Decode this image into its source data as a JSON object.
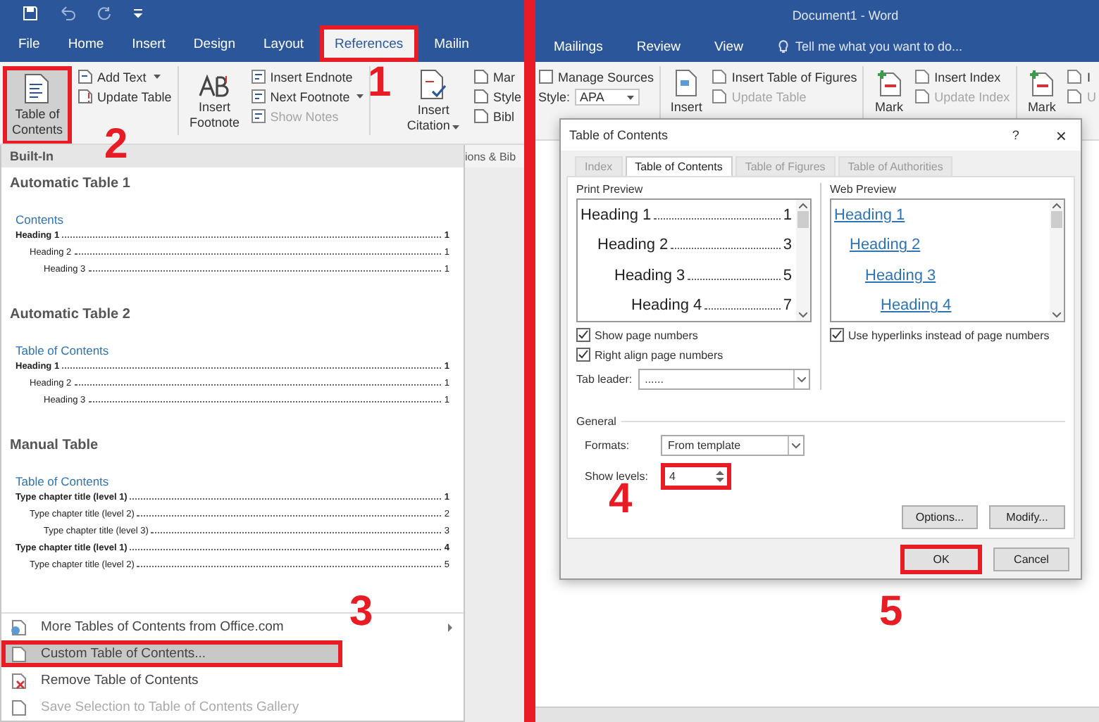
{
  "left": {
    "tabs": [
      {
        "label": "File",
        "selected": false,
        "annotated": false
      },
      {
        "label": "Home",
        "selected": false,
        "annotated": false
      },
      {
        "label": "Insert",
        "selected": false,
        "annotated": false
      },
      {
        "label": "Design",
        "selected": false,
        "annotated": false
      },
      {
        "label": "Layout",
        "selected": false,
        "annotated": false
      },
      {
        "label": "References",
        "selected": true,
        "annotated": true
      },
      {
        "label": "Mailin",
        "selected": false,
        "annotated": false
      }
    ],
    "ribbon": {
      "toc": {
        "label": "Table of Contents",
        "annotated": true
      },
      "small_a": [
        {
          "label": "Add Text",
          "dropdown": true,
          "disabled": false
        },
        {
          "label": "Update Table",
          "dropdown": false,
          "disabled": false
        }
      ],
      "footnote": {
        "label": "Insert Footnote"
      },
      "small_b": [
        {
          "label": "Insert Endnote",
          "dropdown": false,
          "disabled": false
        },
        {
          "label": "Next Footnote",
          "dropdown": true,
          "disabled": false
        },
        {
          "label": "Show Notes",
          "dropdown": false,
          "disabled": true
        }
      ],
      "citation": {
        "label": "Insert Citation",
        "dropdown": true
      },
      "small_c": [
        {
          "label": "Mar",
          "disabled": false
        },
        {
          "label": "Style",
          "disabled": false
        },
        {
          "label": "Bibl",
          "disabled": false
        }
      ],
      "group_label": "ions & Bib"
    },
    "gallery": {
      "header": "Built-In",
      "sections": [
        {
          "title": "Automatic Table 1",
          "heading": "Contents",
          "entries": [
            {
              "text": "Heading 1",
              "page": "1",
              "children": [
                {
                  "text": "Heading 2",
                  "page": "1",
                  "children": [
                    {
                      "text": "Heading 3",
                      "page": "1"
                    }
                  ]
                }
              ]
            }
          ]
        },
        {
          "title": "Automatic Table 2",
          "heading": "Table of Contents",
          "entries": [
            {
              "text": "Heading 1",
              "page": "1",
              "children": [
                {
                  "text": "Heading 2",
                  "page": "1",
                  "children": [
                    {
                      "text": "Heading 3",
                      "page": "1"
                    }
                  ]
                }
              ]
            }
          ]
        },
        {
          "title": "Manual Table",
          "heading": "Table of Contents",
          "entries": [
            {
              "text": "Type chapter title (level 1)",
              "page": "1",
              "children": [
                {
                  "text": "Type chapter title (level 2)",
                  "page": "2",
                  "children": [
                    {
                      "text": "Type chapter title (level 3)",
                      "page": "3"
                    }
                  ]
                }
              ]
            },
            {
              "text": "Type chapter title (level 1)",
              "page": "4",
              "children": [
                {
                  "text": "Type chapter title (level 2)",
                  "page": "5"
                }
              ]
            }
          ]
        }
      ],
      "menu": [
        {
          "label": "More Tables of Contents from Office.com",
          "submenu": true,
          "highlighted": false,
          "annotated": false,
          "disabled": false
        },
        {
          "label": "Custom Table of Contents...",
          "submenu": false,
          "highlighted": true,
          "annotated": true,
          "disabled": false
        },
        {
          "label": "Remove Table of Contents",
          "submenu": false,
          "highlighted": false,
          "annotated": false,
          "disabled": false
        },
        {
          "label": "Save Selection to Table of Contents Gallery",
          "submenu": false,
          "highlighted": false,
          "annotated": false,
          "disabled": true
        }
      ]
    }
  },
  "right": {
    "title": "Document1 - Word",
    "tabs": [
      {
        "label": "Mailings",
        "selected": false
      },
      {
        "label": "Review",
        "selected": false
      },
      {
        "label": "View",
        "selected": false
      }
    ],
    "tell_me": "Tell me what you want to do...",
    "ribbon": {
      "manage_sources": "Manage Sources",
      "style_label": "Style:",
      "style_value": "APA",
      "insert": "Insert",
      "small_b": [
        {
          "label": "Insert Table of Figures",
          "disabled": false
        },
        {
          "label": "Update Table",
          "disabled": true
        }
      ],
      "mark_a": "Mark",
      "small_c": [
        {
          "label": "Insert Index",
          "disabled": false
        },
        {
          "label": "Update Index",
          "disabled": true
        }
      ],
      "mark_b": "Mark",
      "small_d": [
        {
          "label": "I",
          "disabled": false
        },
        {
          "label": "U",
          "disabled": true
        }
      ]
    },
    "dialog": {
      "title": "Table of Contents",
      "help": "?",
      "close": "×",
      "tabs": [
        {
          "label": "Index",
          "selected": false
        },
        {
          "label": "Table of Contents",
          "selected": true
        },
        {
          "label": "Table of Figures",
          "selected": false
        },
        {
          "label": "Table of Authorities",
          "selected": false
        }
      ],
      "print_label": "Print Preview",
      "print_entries": [
        {
          "text": "Heading 1",
          "page": "1",
          "children": [
            {
              "text": "Heading 2",
              "page": "3",
              "children": [
                {
                  "text": "Heading 3",
                  "page": "5",
                  "children": [
                    {
                      "text": "Heading 4",
                      "page": "7"
                    }
                  ]
                }
              ]
            }
          ]
        }
      ],
      "web_label": "Web Preview",
      "web_entries": [
        {
          "text": "Heading 1",
          "children": [
            {
              "text": "Heading 2",
              "children": [
                {
                  "text": "Heading 3",
                  "children": [
                    {
                      "text": "Heading 4"
                    }
                  ]
                }
              ]
            }
          ]
        }
      ],
      "print_checks": [
        {
          "label": "Show page numbers",
          "checked": true
        },
        {
          "label": "Right align page numbers",
          "checked": true
        }
      ],
      "web_check": {
        "label": "Use hyperlinks instead of page numbers",
        "checked": true
      },
      "tab_leader_label": "Tab leader:",
      "tab_leader_value": "......",
      "general": "General",
      "formats_label": "Formats:",
      "formats_value": "From template",
      "levels_label": "Show levels:",
      "levels_value": "4",
      "levels_annotated": true,
      "buttons": [
        {
          "label": "Options...",
          "annotated": false
        },
        {
          "label": "Modify...",
          "annotated": false
        }
      ],
      "footer_buttons": [
        {
          "label": "OK",
          "annotated": true
        },
        {
          "label": "Cancel",
          "annotated": false
        }
      ]
    }
  },
  "annotations": [
    "1",
    "2",
    "3",
    "4",
    "5"
  ]
}
